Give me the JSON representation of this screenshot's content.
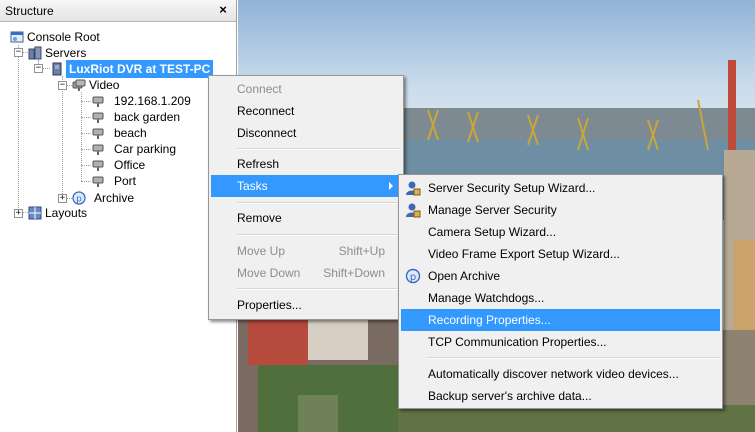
{
  "panel": {
    "title": "Structure",
    "close": "×"
  },
  "tree": {
    "console_root": "Console Root",
    "servers": "Servers",
    "server": "LuxRiot DVR at TEST-PC",
    "video": "Video",
    "cameras": [
      "192.168.1.209",
      "back garden",
      "beach",
      "Car parking",
      "Office",
      "Port"
    ],
    "archive": "Archive",
    "layouts": "Layouts"
  },
  "context_menu": {
    "connect": "Connect",
    "reconnect": "Reconnect",
    "disconnect": "Disconnect",
    "refresh": "Refresh",
    "tasks": "Tasks",
    "remove": "Remove",
    "move_up": "Move Up",
    "move_up_shortcut": "Shift+Up",
    "move_down": "Move Down",
    "move_down_shortcut": "Shift+Down",
    "properties": "Properties..."
  },
  "tasks_menu": {
    "server_security_wizard": "Server Security Setup Wizard...",
    "manage_server_security": "Manage Server Security",
    "camera_setup_wizard": "Camera Setup Wizard...",
    "video_frame_export_wizard": "Video Frame Export Setup Wizard...",
    "open_archive": "Open Archive",
    "manage_watchdogs": "Manage Watchdogs...",
    "recording_properties": "Recording Properties...",
    "tcp_properties": "TCP Communication Properties...",
    "auto_discover": "Automatically discover network video devices...",
    "backup_archive": "Backup server's archive data..."
  },
  "colors": {
    "highlight": "#3399ff",
    "menu_bg": "#f0f0f0",
    "disabled_text": "#8d8d8d"
  }
}
